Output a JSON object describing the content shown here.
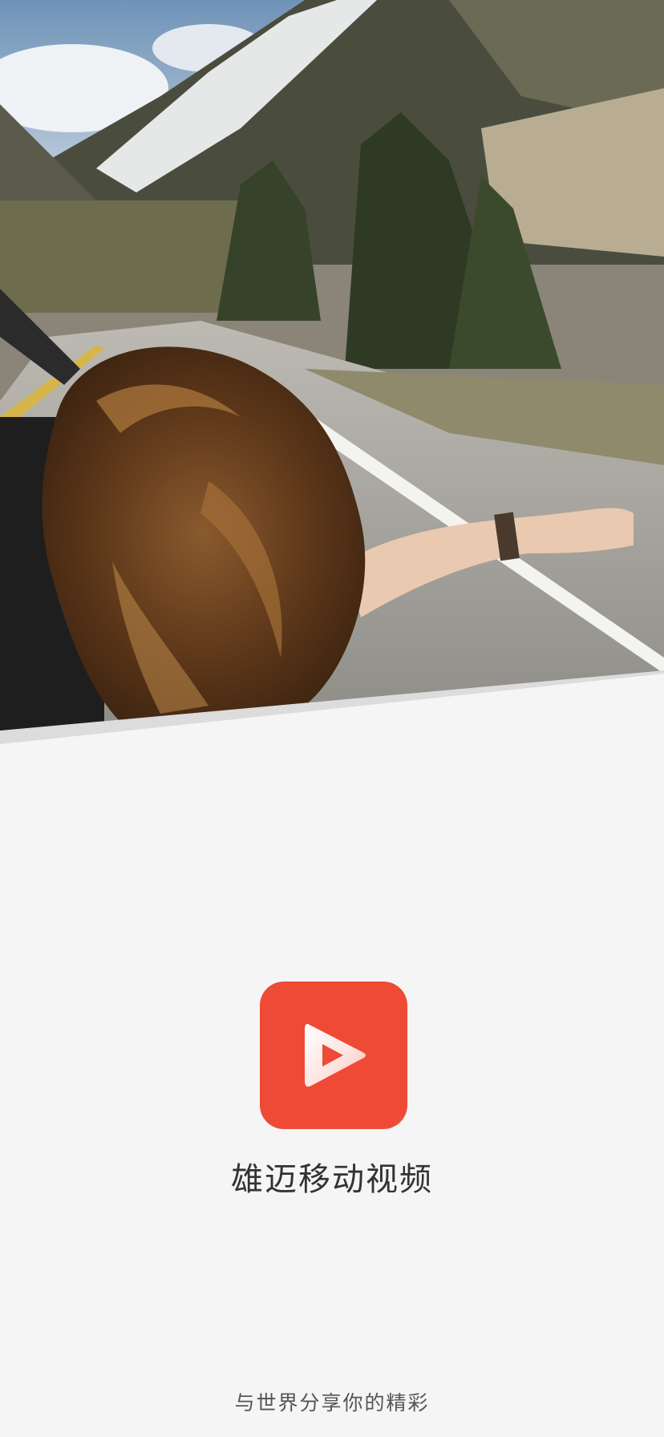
{
  "hero": {
    "image": "woman-hair-blowing-car-window-mountain-road-photo"
  },
  "app": {
    "name": "雄迈移动视频",
    "icon": "play-triangle-icon",
    "icon_color": "#ee4a35"
  },
  "slogan": "与世界分享你的精彩",
  "colors": {
    "background": "#f5f5f5",
    "text_primary": "#333333",
    "text_secondary": "#555555"
  }
}
